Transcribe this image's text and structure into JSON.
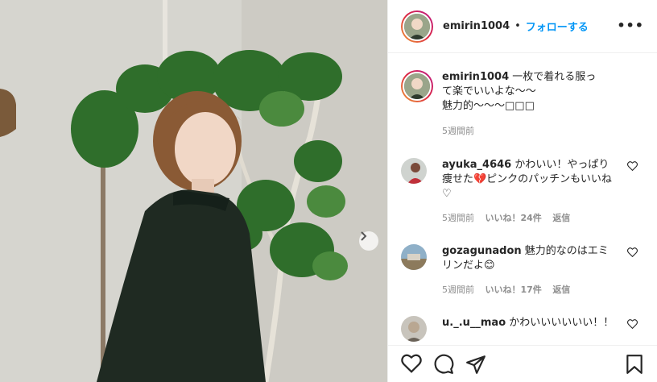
{
  "header": {
    "username": "emirin1004",
    "separator": "•",
    "follow_label": "フォローする",
    "more_label": "•••"
  },
  "caption": {
    "username": "emirin1004",
    "text": "一枚で着れる服って楽でいいよな〜〜\n魅力的〜〜〜□□□",
    "time": "5週間前"
  },
  "comments": [
    {
      "username": "ayuka_4646",
      "text": "かわいい！やっぱり痩せた💔ピンクのパッチンもいいね♡",
      "time": "5週間前",
      "likes": "いいね！24件",
      "reply": "返信"
    },
    {
      "username": "gozagunadon",
      "text": "魅力的なのはエミリンだよ😊",
      "time": "5週間前",
      "likes": "いいね！17件",
      "reply": "返信"
    },
    {
      "username": "u._.u__mao",
      "text": "かわいいいいいい！！"
    }
  ],
  "icons": {
    "next": "chevron-right-icon",
    "like": "heart-icon",
    "comment": "speech-bubble-icon",
    "share": "paper-plane-icon",
    "save": "bookmark-icon"
  },
  "colors": {
    "accent": "#0095f6",
    "text": "#262626",
    "muted": "#8e8e8e",
    "plant": "#2e6b2a",
    "dress": "#1f2a22"
  }
}
